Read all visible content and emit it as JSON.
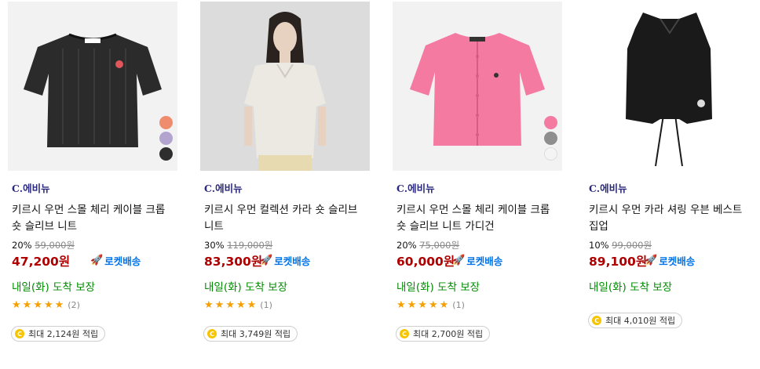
{
  "products": [
    {
      "brand": "C.에비뉴",
      "name": "키르시 우먼 스몰 체리 케이블 크롭 숏 슬리브 니트",
      "discount": "20%",
      "original_price": "59,000원",
      "price": "47,200원",
      "shipping": "로켓배송",
      "arrival": "내일(화) 도착 보장",
      "rating": 5,
      "review_count": "(2)",
      "points": "최대 2,124원 적립",
      "image_color": "#2b2b2b",
      "swatches": [
        "#f08c6e",
        "#b3a4cf",
        "#2e2e2e"
      ]
    },
    {
      "brand": "C.에비뉴",
      "name": "키르시 우먼 컬렉션 카라 숏 슬리브 니트",
      "discount": "30%",
      "original_price": "119,000원",
      "price": "83,300원",
      "shipping": "로켓배송",
      "arrival": "내일(화) 도착 보장",
      "rating": 5,
      "review_count": "(1)",
      "points": "최대 3,749원 적립",
      "image_color": "#ece9e2",
      "swatches": []
    },
    {
      "brand": "C.에비뉴",
      "name": "키르시 우먼 스몰 체리 케이블 크롭 숏 슬리브 니트 가디건",
      "discount": "20%",
      "original_price": "75,000원",
      "price": "60,000원",
      "shipping": "로켓배송",
      "arrival": "내일(화) 도착 보장",
      "rating": 5,
      "review_count": "(1)",
      "points": "최대 2,700원 적립",
      "image_color": "#f47aa2",
      "swatches": [
        "#f47aa2",
        "#8e8e8e",
        "#f4f4f4"
      ]
    },
    {
      "brand": "C.에비뉴",
      "name": "키르시 우먼 카라 셔링 우븐 베스트 집업",
      "discount": "10%",
      "original_price": "99,000원",
      "price": "89,100원",
      "shipping": "로켓배송",
      "arrival": "내일(화) 도착 보장",
      "rating": null,
      "review_count": "",
      "points": "최대 4,010원 적립",
      "image_color": "#1a1a1a",
      "swatches": []
    }
  ],
  "colors": {
    "price_red": "#ae0000",
    "rocket_blue": "#0073e9",
    "arrival_green": "#008c00",
    "star_orange": "#f59f00",
    "brand_navy": "#2b2a7e"
  }
}
